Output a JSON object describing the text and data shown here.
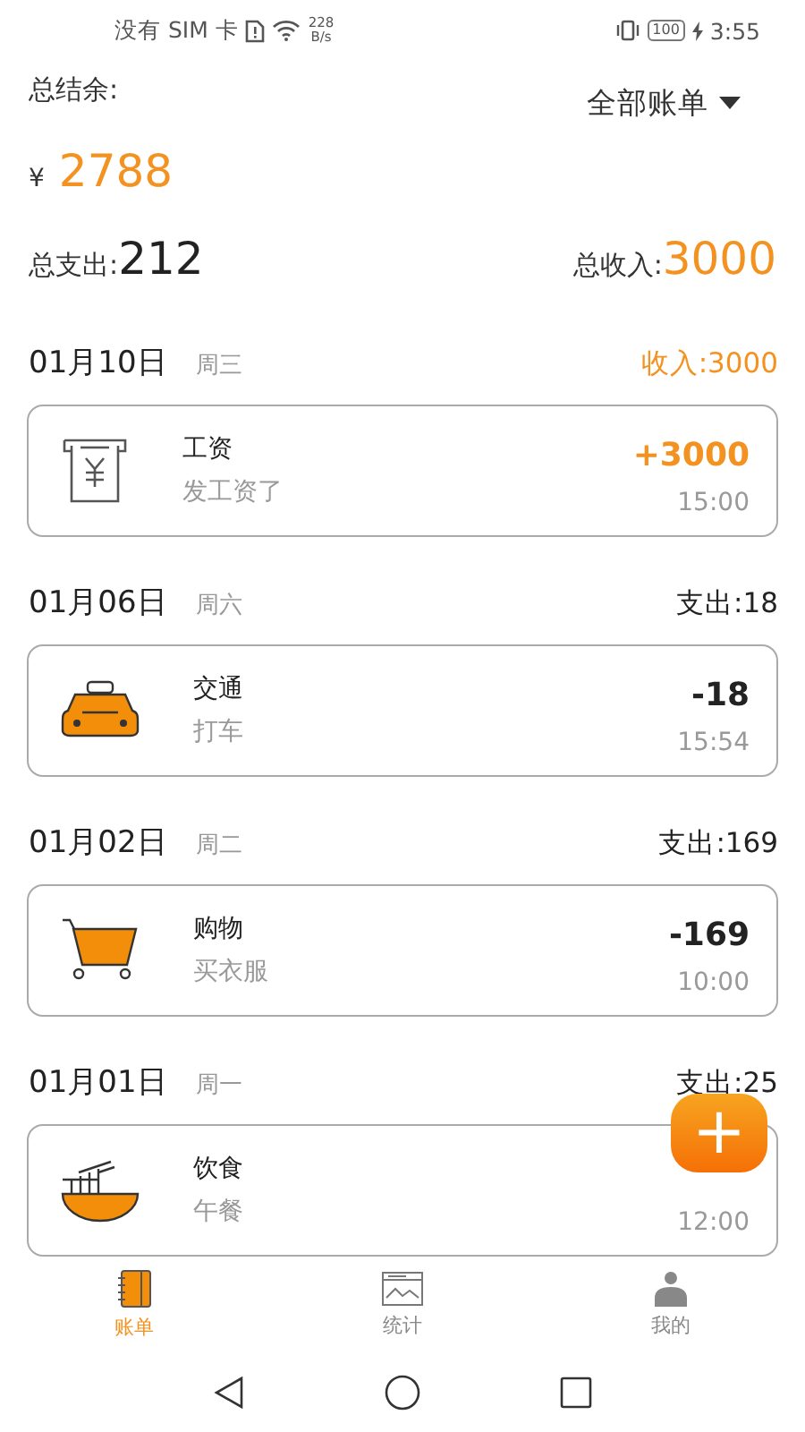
{
  "status_bar": {
    "carrier": "没有 SIM 卡",
    "speed_value": "228",
    "speed_unit": "B/s",
    "battery": "100",
    "time": "3:55"
  },
  "summary": {
    "balance_label": "总结余:",
    "filter": "全部账单",
    "currency": "¥",
    "balance": "2788",
    "expense_label": "总支出:",
    "expense": "212",
    "income_label": "总收入:",
    "income": "3000"
  },
  "days": [
    {
      "date": "01月10日",
      "weekday": "周三",
      "total": "收入:3000",
      "color": "#f39221",
      "entries": [
        {
          "kind": "salary",
          "category": "工资",
          "note": "发工资了",
          "amount": "+3000",
          "color": "#f39221",
          "time": "15:00"
        }
      ]
    },
    {
      "date": "01月06日",
      "weekday": "周六",
      "total": "支出:18",
      "color": "#222222",
      "entries": [
        {
          "kind": "taxi",
          "category": "交通",
          "note": "打车",
          "amount": "-18",
          "color": "#222222",
          "time": "15:54"
        }
      ]
    },
    {
      "date": "01月02日",
      "weekday": "周二",
      "total": "支出:169",
      "color": "#222222",
      "entries": [
        {
          "kind": "cart",
          "category": "购物",
          "note": "买衣服",
          "amount": "-169",
          "color": "#222222",
          "time": "10:00"
        }
      ]
    },
    {
      "date": "01月01日",
      "weekday": "周一",
      "total": "支出:25",
      "color": "#222222",
      "entries": [
        {
          "kind": "bowl",
          "category": "饮食",
          "note": "午餐",
          "time": "12:00"
        }
      ]
    }
  ],
  "fab": {
    "label": "+"
  },
  "tabs": [
    {
      "kind": "ledger",
      "label": "账单",
      "selected": true
    },
    {
      "kind": "chart",
      "label": "统计",
      "selected": false
    },
    {
      "kind": "person",
      "label": "我的",
      "selected": false
    }
  ]
}
